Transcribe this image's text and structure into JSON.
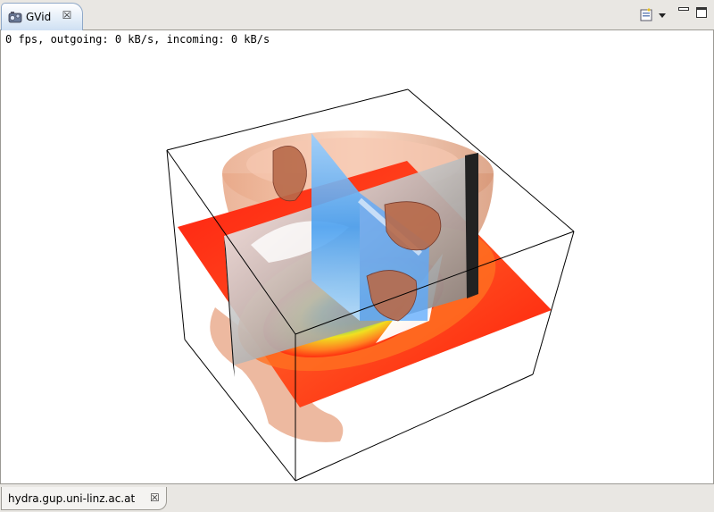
{
  "view": {
    "tab_title": "GVid",
    "tab_icon": "gvid-app-icon",
    "close_glyph": "☒"
  },
  "toolbar": {
    "view_menu_icon": "view-menu-icon",
    "minimize_icon": "minimize-icon",
    "maximize_icon": "maximize-icon"
  },
  "status": {
    "text": "0 fps, outgoing: 0 kB/s, incoming: 0 kB/s"
  },
  "viewport": {
    "content": "3d-volume-render"
  },
  "bottom_tab": {
    "label": "hydra.gup.uni-linz.ac.at",
    "close_glyph": "☒"
  },
  "colors": {
    "tab_active_top": "#ffffff",
    "tab_active_bottom": "#cfe0f3",
    "slice_red": "#ff2a10",
    "slice_orange": "#ff8020",
    "surface_skin": "#f0b090",
    "slice_blue": "#5aaaff"
  }
}
